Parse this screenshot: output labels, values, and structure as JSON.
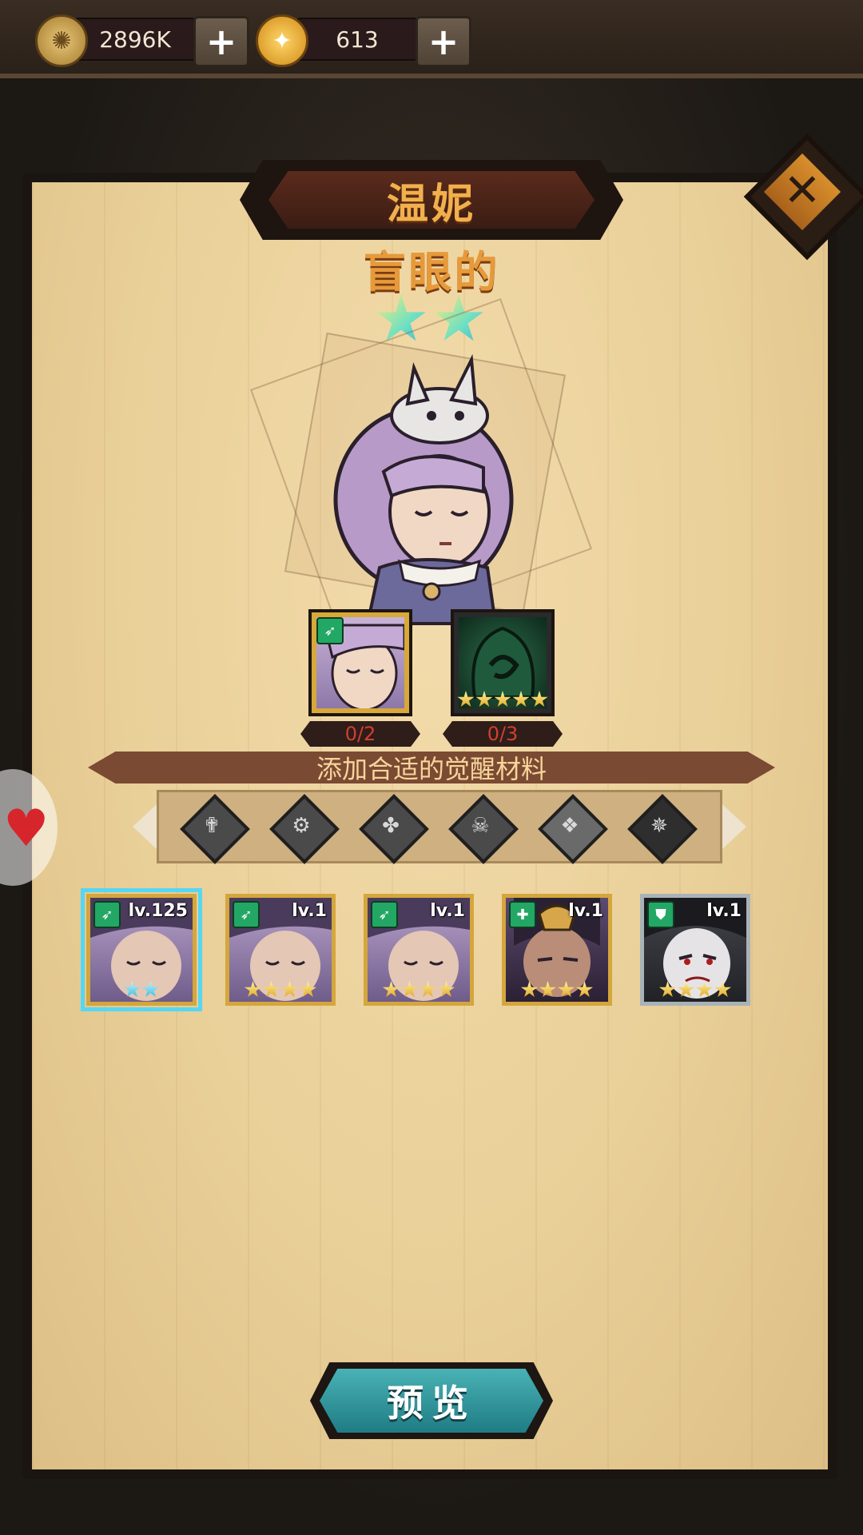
{
  "currency": {
    "gold": {
      "icon": "gold-coin-icon",
      "amount": "2896K"
    },
    "gems": {
      "icon": "gem-coin-icon",
      "amount": "613"
    }
  },
  "hero": {
    "name": "温妮",
    "title": "盲眼的",
    "star_count": 2
  },
  "slots": [
    {
      "name": "hero-copy-slot",
      "count": "0/2"
    },
    {
      "name": "hooded-material-slot",
      "count": "0/3"
    }
  ],
  "banner": "添加合适的觉醒材料",
  "filters": [
    {
      "icon": "faction-cross-icon"
    },
    {
      "icon": "faction-gear-icon"
    },
    {
      "icon": "faction-clover-icon"
    },
    {
      "icon": "faction-skull-icon"
    },
    {
      "icon": "faction-wing-icon"
    },
    {
      "icon": "faction-dark-icon"
    }
  ],
  "cards": [
    {
      "level": "lv.125",
      "stars": 2,
      "star_color": "cyan",
      "badge": "bow-class-icon",
      "selected": true,
      "frame": "gold"
    },
    {
      "level": "lv.1",
      "stars": 4,
      "star_color": "gold",
      "badge": "bow-class-icon",
      "selected": false,
      "frame": "gold"
    },
    {
      "level": "lv.1",
      "stars": 4,
      "star_color": "gold",
      "badge": "bow-class-icon",
      "selected": false,
      "frame": "gold"
    },
    {
      "level": "lv.1",
      "stars": 4,
      "star_color": "gold",
      "badge": "healer-class-icon",
      "selected": false,
      "frame": "gold"
    },
    {
      "level": "lv.1",
      "stars": 4,
      "star_color": "gold",
      "badge": "shield-class-icon",
      "selected": false,
      "frame": "silver"
    }
  ],
  "preview_button": "预览",
  "colors": {
    "accent_orange": "#e69a3a",
    "count_red": "#d13f32",
    "select_cyan": "#56d6f3",
    "button_teal": "#2f9aa0"
  }
}
